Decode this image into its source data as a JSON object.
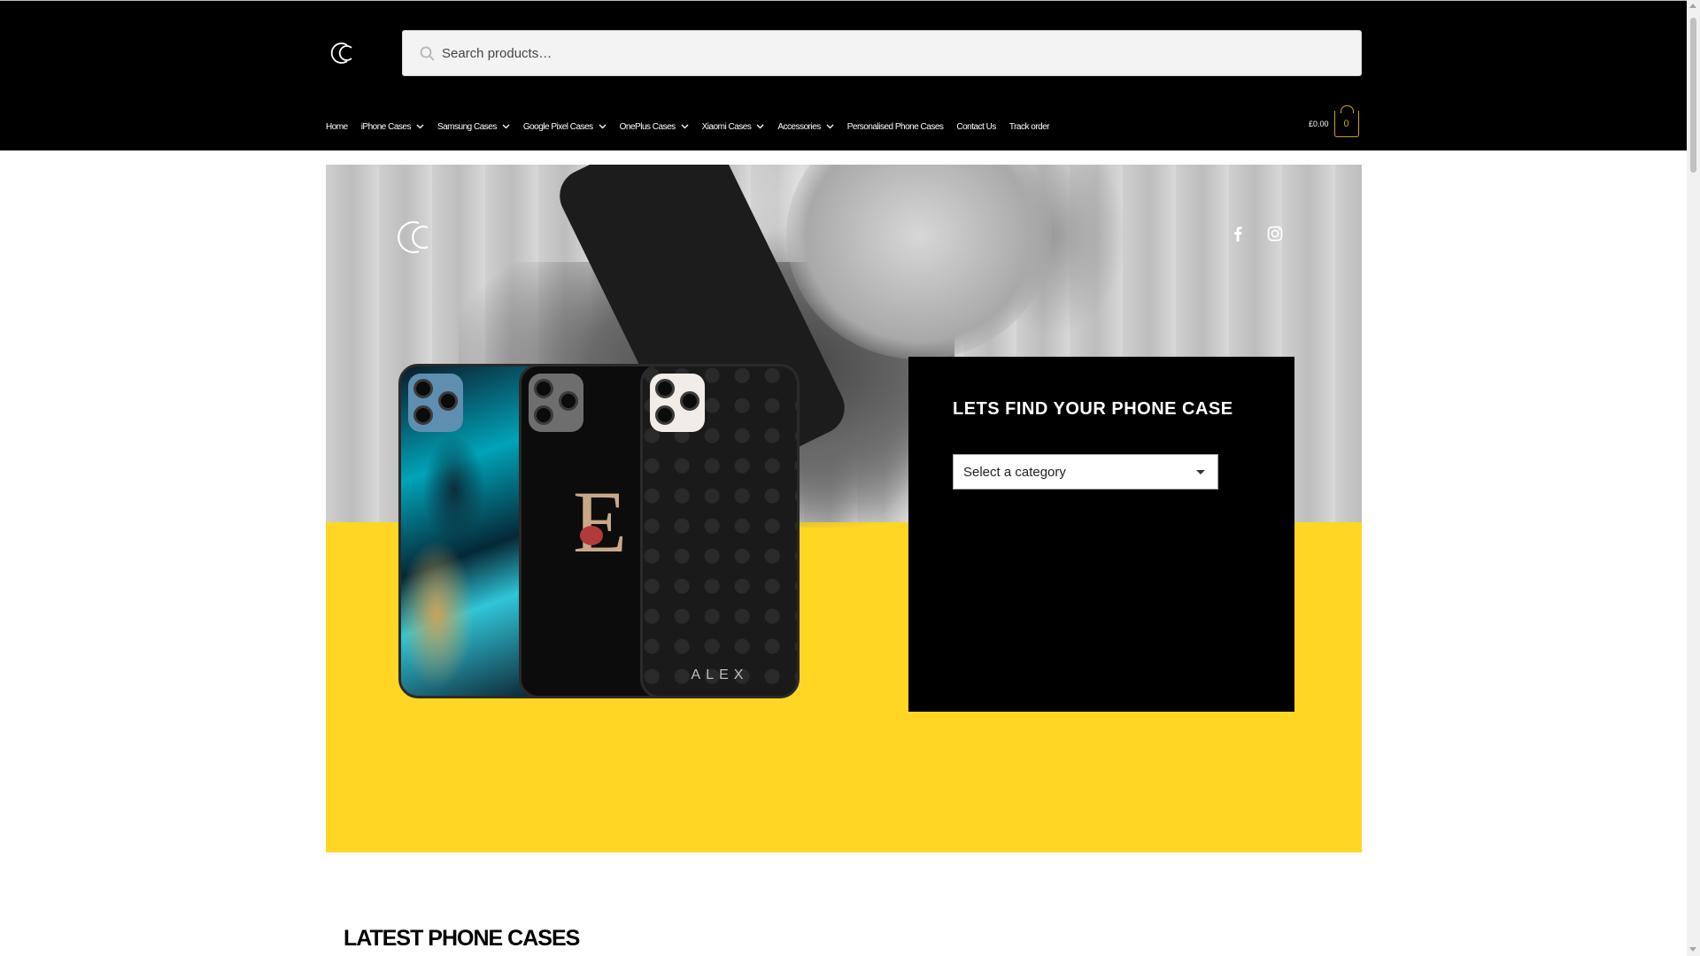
{
  "header": {
    "logo": "CC-logo",
    "search": {
      "icon": "search-icon",
      "placeholder": "Search products…"
    },
    "nav": [
      {
        "label": "Home",
        "has_dropdown": false
      },
      {
        "label": "iPhone Cases",
        "has_dropdown": true
      },
      {
        "label": "Samsung Cases",
        "has_dropdown": true
      },
      {
        "label": "Google Pixel Cases",
        "has_dropdown": true
      },
      {
        "label": "OnePlus Cases",
        "has_dropdown": true
      },
      {
        "label": "Xiaomi Cases",
        "has_dropdown": true
      },
      {
        "label": "Accessories",
        "has_dropdown": true
      },
      {
        "label": "Personalised Phone Cases",
        "has_dropdown": false
      },
      {
        "label": "Contact Us",
        "has_dropdown": false
      },
      {
        "label": "Track order",
        "has_dropdown": false
      }
    ],
    "cart": {
      "total": "£0.00",
      "count": "0",
      "icon": "shopping-bag-icon"
    }
  },
  "hero": {
    "social": [
      {
        "name": "facebook-icon"
      },
      {
        "name": "instagram-icon"
      }
    ],
    "phone_name": "ALEX",
    "phone_letter": "E",
    "finder": {
      "title": "LETS FIND YOUR PHONE CASE",
      "select_value": "Select a category"
    }
  },
  "main": {
    "section_title": "LATEST PHONE CASES"
  },
  "colors": {
    "header_bg": "#000000",
    "accent_yellow": "#ffd624",
    "cart_gold": "#c9a227",
    "panel_bg": "#000000"
  }
}
